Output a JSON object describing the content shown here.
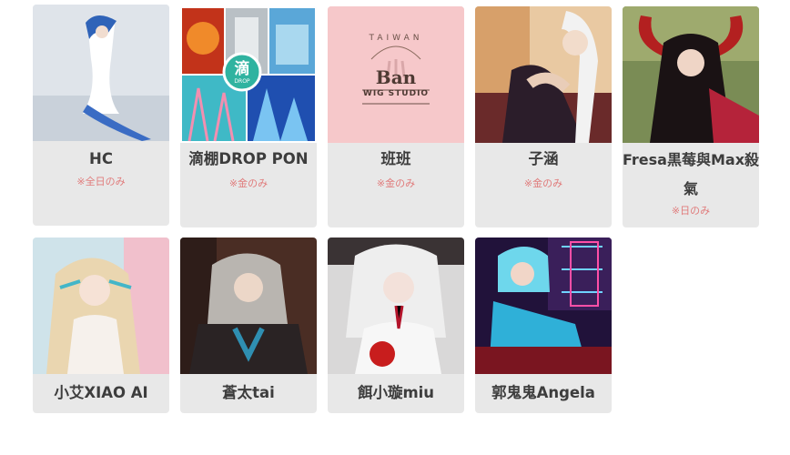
{
  "cards": [
    {
      "name": "HC",
      "note": "※全日のみ",
      "thumb_icon": "cosplay-photo-icon"
    },
    {
      "name": "滴棚DROP PON",
      "note": "※金のみ",
      "thumb_icon": "collage-photo-icon",
      "logo_char": "滴",
      "logo_sub": "DROP"
    },
    {
      "name": "班班",
      "note": "※金のみ",
      "thumb_icon": "brand-logo-icon",
      "logo_top": "TAIWAN",
      "logo_main": "Ban",
      "logo_sub": "WIG STUDIO"
    },
    {
      "name": "子涵",
      "note": "※金のみ",
      "thumb_icon": "cosplay-photo-icon"
    },
    {
      "name": "Fresa黒莓與Max殺氣",
      "note": "※日のみ",
      "thumb_icon": "cosplay-photo-icon"
    },
    {
      "name": "小艾XIAO AI",
      "thumb_icon": "cosplay-photo-icon"
    },
    {
      "name": "蒼太tai",
      "thumb_icon": "cosplay-photo-icon"
    },
    {
      "name": "餌小璇miu",
      "thumb_icon": "cosplay-photo-icon"
    },
    {
      "name": "郭鬼鬼Angela",
      "thumb_icon": "cosplay-photo-icon"
    }
  ],
  "colors": {
    "card_bg": "#e8e8e8",
    "name_text": "#3d3d3d",
    "note_text": "#e07b7b",
    "ban_bg": "#f6c8ca"
  }
}
